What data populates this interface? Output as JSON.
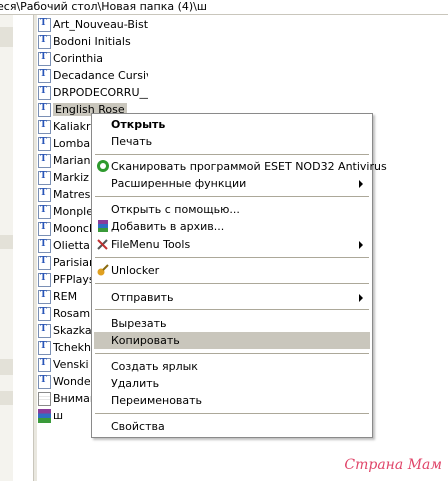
{
  "address": {
    "path": "еся\\Рабочий стол\\Новая папка (4)\\ш"
  },
  "files": [
    {
      "name": "Art_Nouveau-Bistro",
      "icon": "font-icon"
    },
    {
      "name": "Bodoni Initials",
      "icon": "font-icon"
    },
    {
      "name": "Corinthia",
      "icon": "font-icon"
    },
    {
      "name": "Decadance Cursiv",
      "icon": "font-icon"
    },
    {
      "name": "DRPODECORRU__",
      "icon": "font-icon"
    },
    {
      "name": "English Rose",
      "icon": "font-icon",
      "selected": true
    },
    {
      "name": "Kaliakra",
      "icon": "font-icon"
    },
    {
      "name": "Lombard",
      "icon": "font-icon"
    },
    {
      "name": "Mariann",
      "icon": "font-icon"
    },
    {
      "name": "Markiz c",
      "icon": "font-icon"
    },
    {
      "name": "Matresh",
      "icon": "font-icon"
    },
    {
      "name": "Monples",
      "icon": "font-icon"
    },
    {
      "name": "Moonch",
      "icon": "font-icon"
    },
    {
      "name": "Olietta s",
      "icon": "font-icon"
    },
    {
      "name": "Parisian",
      "icon": "font-icon"
    },
    {
      "name": "PFPlays",
      "icon": "font-icon"
    },
    {
      "name": "REM",
      "icon": "font-icon"
    },
    {
      "name": "Rosamu",
      "icon": "font-icon"
    },
    {
      "name": "SkazkaF",
      "icon": "font-icon"
    },
    {
      "name": "Tchekho",
      "icon": "font-icon"
    },
    {
      "name": "Venski S",
      "icon": "font-icon"
    },
    {
      "name": "Wonder",
      "icon": "font-icon"
    },
    {
      "name": "Вниман",
      "icon": "text-document-icon"
    },
    {
      "name": "ш",
      "icon": "rar-archive-icon"
    }
  ],
  "context_menu": {
    "items": [
      {
        "label": "Открыть",
        "bold": true
      },
      {
        "label": "Печать"
      },
      {
        "label": "Сканировать программой ESET NOD32 Antivirus",
        "icon": "eset-icon"
      },
      {
        "label": "Расширенные функции",
        "submenu": true
      },
      {
        "label": "Открыть с помощью..."
      },
      {
        "label": "Добавить в архив...",
        "icon": "winrar-icon"
      },
      {
        "label": "FileMenu Tools",
        "icon": "tools-icon",
        "submenu": true
      },
      {
        "label": "Unlocker",
        "icon": "unlocker-icon"
      },
      {
        "label": "Отправить",
        "submenu": true
      },
      {
        "label": "Вырезать"
      },
      {
        "label": "Копировать",
        "highlighted": true
      },
      {
        "label": "Создать ярлык"
      },
      {
        "label": "Удалить"
      },
      {
        "label": "Переименовать"
      },
      {
        "label": "Свойства"
      }
    ]
  },
  "watermark": {
    "text": "Страна Мам"
  },
  "colors": {
    "highlight": "#c9c6bc",
    "watermark": "#e0466a",
    "eset_green": "#2e9a2e"
  }
}
